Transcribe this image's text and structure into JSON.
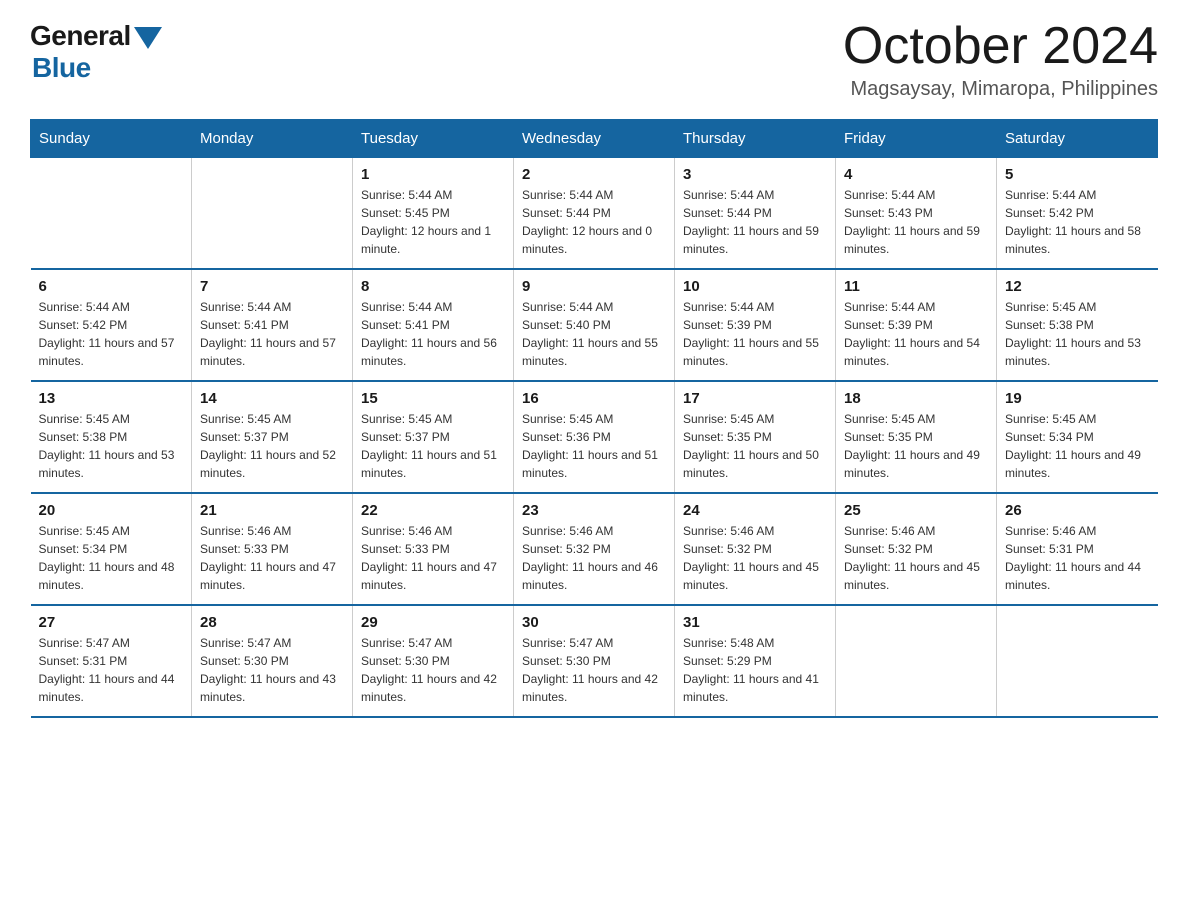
{
  "header": {
    "logo_general": "General",
    "logo_blue": "Blue",
    "month_title": "October 2024",
    "location": "Magsaysay, Mimaropa, Philippines"
  },
  "days_of_week": [
    "Sunday",
    "Monday",
    "Tuesday",
    "Wednesday",
    "Thursday",
    "Friday",
    "Saturday"
  ],
  "weeks": [
    [
      {
        "day": "",
        "info": ""
      },
      {
        "day": "",
        "info": ""
      },
      {
        "day": "1",
        "info": "Sunrise: 5:44 AM\nSunset: 5:45 PM\nDaylight: 12 hours and 1 minute."
      },
      {
        "day": "2",
        "info": "Sunrise: 5:44 AM\nSunset: 5:44 PM\nDaylight: 12 hours and 0 minutes."
      },
      {
        "day": "3",
        "info": "Sunrise: 5:44 AM\nSunset: 5:44 PM\nDaylight: 11 hours and 59 minutes."
      },
      {
        "day": "4",
        "info": "Sunrise: 5:44 AM\nSunset: 5:43 PM\nDaylight: 11 hours and 59 minutes."
      },
      {
        "day": "5",
        "info": "Sunrise: 5:44 AM\nSunset: 5:42 PM\nDaylight: 11 hours and 58 minutes."
      }
    ],
    [
      {
        "day": "6",
        "info": "Sunrise: 5:44 AM\nSunset: 5:42 PM\nDaylight: 11 hours and 57 minutes."
      },
      {
        "day": "7",
        "info": "Sunrise: 5:44 AM\nSunset: 5:41 PM\nDaylight: 11 hours and 57 minutes."
      },
      {
        "day": "8",
        "info": "Sunrise: 5:44 AM\nSunset: 5:41 PM\nDaylight: 11 hours and 56 minutes."
      },
      {
        "day": "9",
        "info": "Sunrise: 5:44 AM\nSunset: 5:40 PM\nDaylight: 11 hours and 55 minutes."
      },
      {
        "day": "10",
        "info": "Sunrise: 5:44 AM\nSunset: 5:39 PM\nDaylight: 11 hours and 55 minutes."
      },
      {
        "day": "11",
        "info": "Sunrise: 5:44 AM\nSunset: 5:39 PM\nDaylight: 11 hours and 54 minutes."
      },
      {
        "day": "12",
        "info": "Sunrise: 5:45 AM\nSunset: 5:38 PM\nDaylight: 11 hours and 53 minutes."
      }
    ],
    [
      {
        "day": "13",
        "info": "Sunrise: 5:45 AM\nSunset: 5:38 PM\nDaylight: 11 hours and 53 minutes."
      },
      {
        "day": "14",
        "info": "Sunrise: 5:45 AM\nSunset: 5:37 PM\nDaylight: 11 hours and 52 minutes."
      },
      {
        "day": "15",
        "info": "Sunrise: 5:45 AM\nSunset: 5:37 PM\nDaylight: 11 hours and 51 minutes."
      },
      {
        "day": "16",
        "info": "Sunrise: 5:45 AM\nSunset: 5:36 PM\nDaylight: 11 hours and 51 minutes."
      },
      {
        "day": "17",
        "info": "Sunrise: 5:45 AM\nSunset: 5:35 PM\nDaylight: 11 hours and 50 minutes."
      },
      {
        "day": "18",
        "info": "Sunrise: 5:45 AM\nSunset: 5:35 PM\nDaylight: 11 hours and 49 minutes."
      },
      {
        "day": "19",
        "info": "Sunrise: 5:45 AM\nSunset: 5:34 PM\nDaylight: 11 hours and 49 minutes."
      }
    ],
    [
      {
        "day": "20",
        "info": "Sunrise: 5:45 AM\nSunset: 5:34 PM\nDaylight: 11 hours and 48 minutes."
      },
      {
        "day": "21",
        "info": "Sunrise: 5:46 AM\nSunset: 5:33 PM\nDaylight: 11 hours and 47 minutes."
      },
      {
        "day": "22",
        "info": "Sunrise: 5:46 AM\nSunset: 5:33 PM\nDaylight: 11 hours and 47 minutes."
      },
      {
        "day": "23",
        "info": "Sunrise: 5:46 AM\nSunset: 5:32 PM\nDaylight: 11 hours and 46 minutes."
      },
      {
        "day": "24",
        "info": "Sunrise: 5:46 AM\nSunset: 5:32 PM\nDaylight: 11 hours and 45 minutes."
      },
      {
        "day": "25",
        "info": "Sunrise: 5:46 AM\nSunset: 5:32 PM\nDaylight: 11 hours and 45 minutes."
      },
      {
        "day": "26",
        "info": "Sunrise: 5:46 AM\nSunset: 5:31 PM\nDaylight: 11 hours and 44 minutes."
      }
    ],
    [
      {
        "day": "27",
        "info": "Sunrise: 5:47 AM\nSunset: 5:31 PM\nDaylight: 11 hours and 44 minutes."
      },
      {
        "day": "28",
        "info": "Sunrise: 5:47 AM\nSunset: 5:30 PM\nDaylight: 11 hours and 43 minutes."
      },
      {
        "day": "29",
        "info": "Sunrise: 5:47 AM\nSunset: 5:30 PM\nDaylight: 11 hours and 42 minutes."
      },
      {
        "day": "30",
        "info": "Sunrise: 5:47 AM\nSunset: 5:30 PM\nDaylight: 11 hours and 42 minutes."
      },
      {
        "day": "31",
        "info": "Sunrise: 5:48 AM\nSunset: 5:29 PM\nDaylight: 11 hours and 41 minutes."
      },
      {
        "day": "",
        "info": ""
      },
      {
        "day": "",
        "info": ""
      }
    ]
  ]
}
